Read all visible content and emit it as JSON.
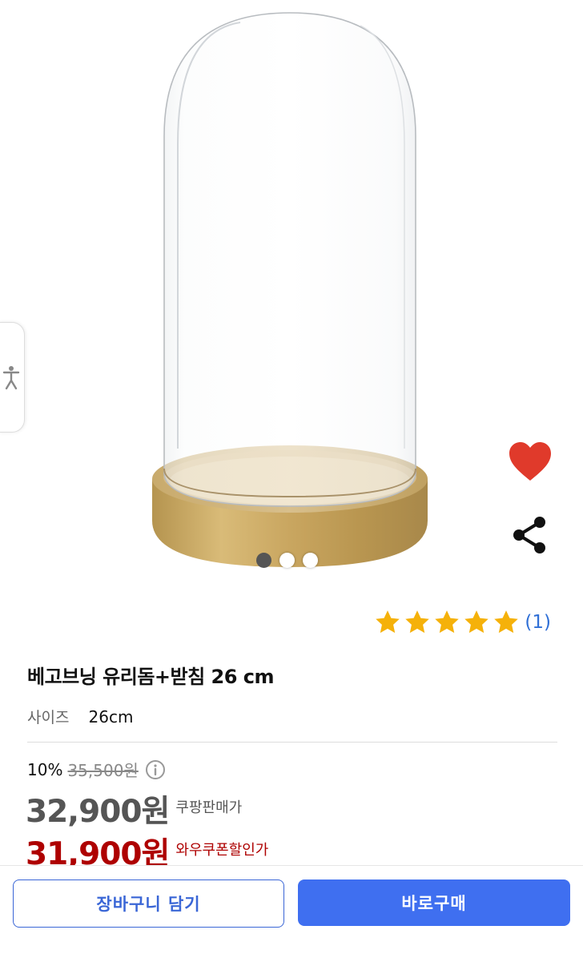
{
  "product": {
    "title": "베고브닝 유리돔+받침 26 cm",
    "image_count": 3,
    "active_image": 1,
    "option_label": "사이즈",
    "option_value": "26cm"
  },
  "rating": {
    "stars": 5,
    "max_stars": 5,
    "count": "(1)",
    "star_color": "#f5b10a"
  },
  "pricing": {
    "discount_percent": "10%",
    "original_price": "35,500원",
    "sale_price": "32,900원",
    "sale_label": "쿠팡판매가",
    "coupon_price": "31,900원",
    "coupon_label": "와우쿠폰할인가",
    "coupon_color": "#ae0000"
  },
  "actions": {
    "cart_label": "장바구니 담기",
    "buy_label": "바로구매",
    "wishlist_color": "#e03a2b",
    "buy_color": "#3f6ff0"
  },
  "icons": {
    "accessibility": "accessibility-icon",
    "wishlist": "heart-icon",
    "share": "share-icon",
    "info": "info-icon",
    "star": "star-icon"
  }
}
